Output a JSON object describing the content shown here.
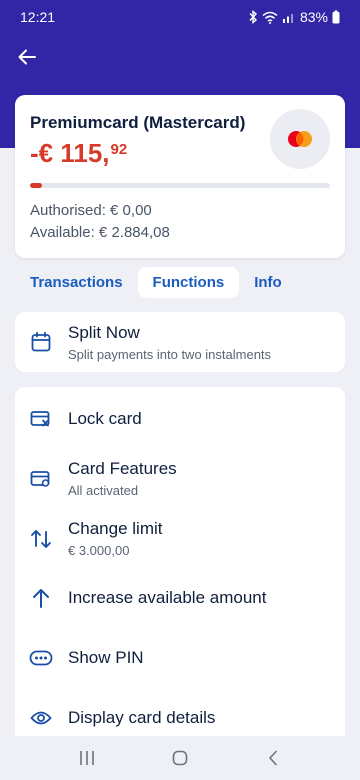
{
  "status_bar": {
    "time": "12:21",
    "battery": "83%"
  },
  "card": {
    "title": "Premiumcard (Mastercard)",
    "balance_main": "-€ 115,",
    "balance_cents": "92",
    "usage_fraction": 0.04,
    "authorised": "Authorised: € 0,00",
    "available": "Available: € 2.884,08",
    "logo_icon": "mastercard-logo"
  },
  "tabs": [
    {
      "label": "Transactions",
      "active": false
    },
    {
      "label": "Functions",
      "active": true
    },
    {
      "label": "Info",
      "active": false
    }
  ],
  "split_now": {
    "title": "Split Now",
    "subtitle": "Split payments into two instalments",
    "icon": "calendar-icon"
  },
  "menu": {
    "lock_card": {
      "title": "Lock card",
      "icon": "card-lock-icon"
    },
    "card_features": {
      "title": "Card Features",
      "subtitle": "All activated",
      "icon": "card-settings-icon"
    },
    "change_limit": {
      "title": "Change limit",
      "subtitle": "€ 3.000,00",
      "icon": "swap-vertical-icon"
    },
    "increase_amount": {
      "title": "Increase available amount",
      "icon": "arrow-up-icon"
    },
    "show_pin": {
      "title": "Show PIN",
      "icon": "pin-dots-icon"
    },
    "card_details": {
      "title": "Display card details",
      "icon": "eye-icon"
    }
  },
  "colors": {
    "header": "#3326a6",
    "accent": "#1a5bbf",
    "negative": "#d63b2a",
    "background": "#eef0f6"
  }
}
